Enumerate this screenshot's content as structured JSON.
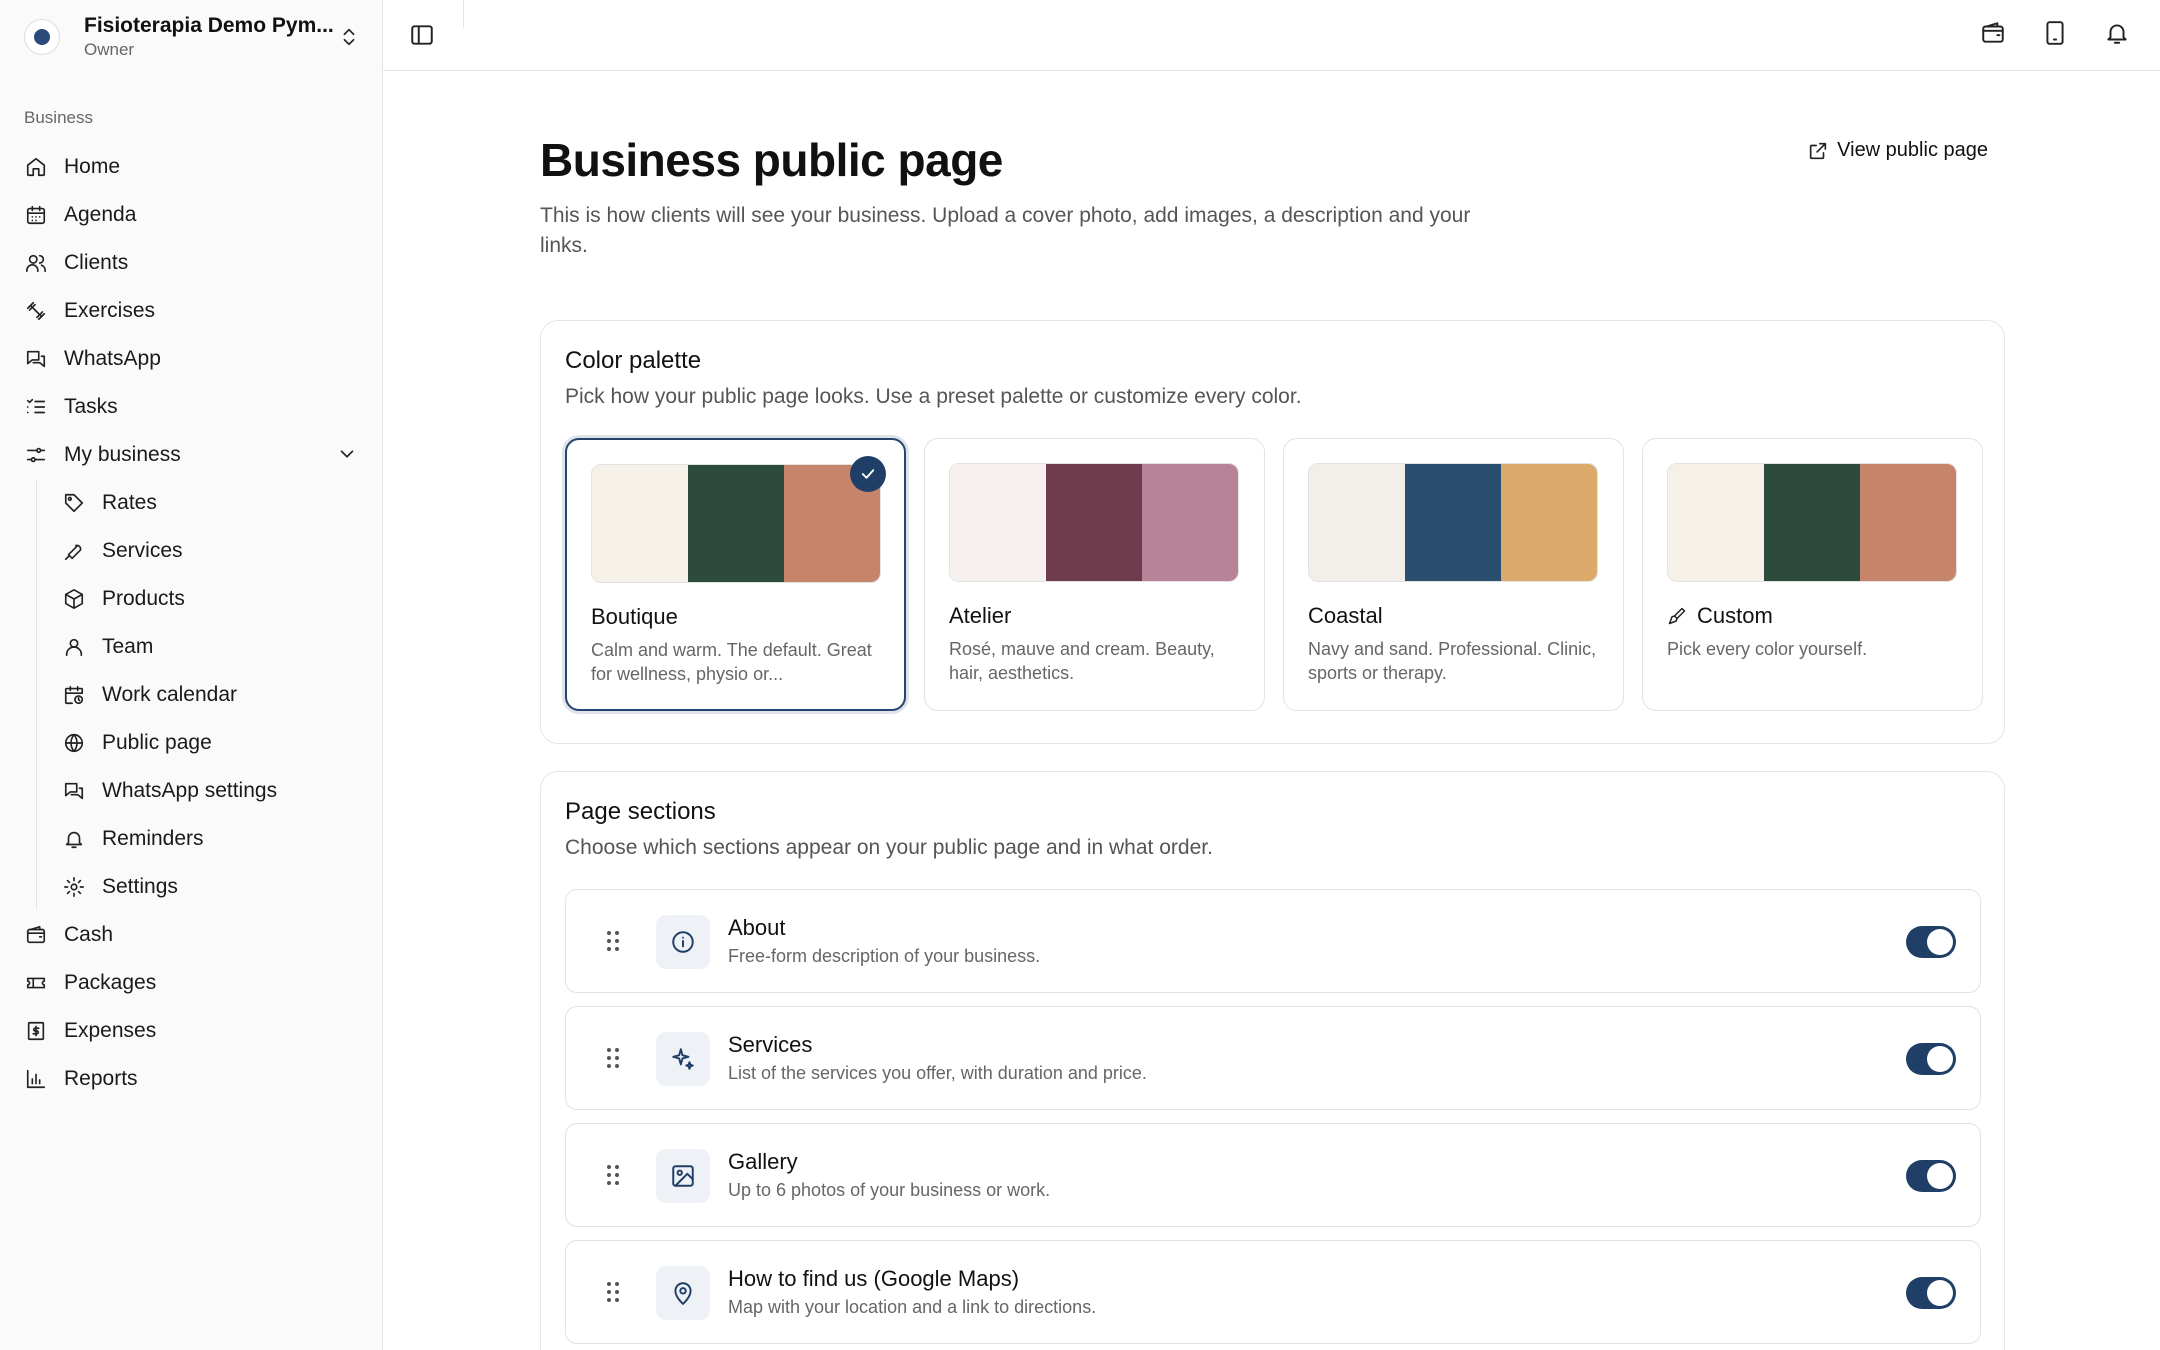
{
  "org": {
    "name": "Fisioterapia Demo Pym...",
    "role": "Owner"
  },
  "sidebar": {
    "section_label": "Business",
    "items": [
      {
        "label": "Home",
        "icon": "home-icon"
      },
      {
        "label": "Agenda",
        "icon": "calendar-icon"
      },
      {
        "label": "Clients",
        "icon": "users-icon"
      },
      {
        "label": "Exercises",
        "icon": "dumbbell-icon"
      },
      {
        "label": "WhatsApp",
        "icon": "chat-icon"
      },
      {
        "label": "Tasks",
        "icon": "list-check-icon"
      },
      {
        "label": "My business",
        "icon": "sliders-icon"
      },
      {
        "label": "Rates",
        "icon": "tag-icon"
      },
      {
        "label": "Services",
        "icon": "wrench-icon"
      },
      {
        "label": "Products",
        "icon": "package-icon"
      },
      {
        "label": "Team",
        "icon": "user-icon"
      },
      {
        "label": "Work calendar",
        "icon": "calendar-clock-icon"
      },
      {
        "label": "Public page",
        "icon": "globe-icon"
      },
      {
        "label": "WhatsApp settings",
        "icon": "chat-icon"
      },
      {
        "label": "Reminders",
        "icon": "bell-icon"
      },
      {
        "label": "Settings",
        "icon": "gear-icon"
      },
      {
        "label": "Cash",
        "icon": "wallet-icon"
      },
      {
        "label": "Packages",
        "icon": "ticket-icon"
      },
      {
        "label": "Expenses",
        "icon": "receipt-icon"
      },
      {
        "label": "Reports",
        "icon": "bar-chart-icon"
      }
    ]
  },
  "header": {
    "title": "Business public page",
    "description": "This is how clients will see your business. Upload a cover photo, add images, a description and your links.",
    "view_link": "View public page"
  },
  "palette": {
    "title": "Color palette",
    "subtitle": "Pick how your public page looks. Use a preset palette or customize every color.",
    "options": [
      {
        "name": "Boutique",
        "desc": "Calm and warm. The default. Great for wellness, physio or...",
        "colors": [
          "#f6f1e8",
          "#2d4b3d",
          "#c6846a"
        ],
        "selected": true
      },
      {
        "name": "Atelier",
        "desc": "Rosé, mauve and cream. Beauty, hair, aesthetics.",
        "colors": [
          "#f6f1ee",
          "#6e3c4c",
          "#b88398"
        ],
        "selected": false
      },
      {
        "name": "Coastal",
        "desc": "Navy and sand. Professional. Clinic, sports or therapy.",
        "colors": [
          "#f1efe8",
          "#2a4e6e",
          "#dba96a"
        ],
        "selected": false
      },
      {
        "name": "Custom",
        "desc": "Pick every color yourself.",
        "colors": [
          "#f6f1e8",
          "#2d4b3d",
          "#c6846a"
        ],
        "selected": false
      }
    ]
  },
  "sections": {
    "title": "Page sections",
    "subtitle": "Choose which sections appear on your public page and in what order.",
    "rows": [
      {
        "title": "About",
        "desc": "Free-form description of your business.",
        "icon": "info-icon",
        "enabled": true
      },
      {
        "title": "Services",
        "desc": "List of the services you offer, with duration and price.",
        "icon": "sparkles-icon",
        "enabled": true
      },
      {
        "title": "Gallery",
        "desc": "Up to 6 photos of your business or work.",
        "icon": "image-icon",
        "enabled": true
      },
      {
        "title": "How to find us (Google Maps)",
        "desc": "Map with your location and a link to directions.",
        "icon": "map-pin-icon",
        "enabled": true
      }
    ]
  },
  "colors": {
    "accent": "#1f3f66"
  }
}
